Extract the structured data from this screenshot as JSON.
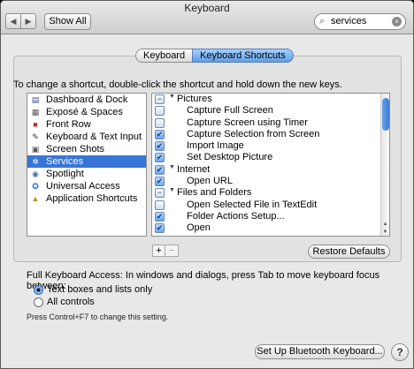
{
  "window": {
    "title": "Keyboard"
  },
  "toolbar": {
    "back_icon": "◀",
    "fwd_icon": "▶",
    "show_all_label": "Show All"
  },
  "search": {
    "value": "services",
    "icon": "⌕",
    "clear_icon": "×"
  },
  "tabs": [
    {
      "label": "Keyboard",
      "selected": false
    },
    {
      "label": "Keyboard Shortcuts",
      "selected": true
    }
  ],
  "instructions": "To change a shortcut, double-click the shortcut and hold down the new keys.",
  "categories": [
    {
      "label": "Dashboard & Dock",
      "icon": "dashboard-icon",
      "glyph": "▤",
      "color": "#3e4f8c",
      "selected": false
    },
    {
      "label": "Exposé & Spaces",
      "icon": "expose-icon",
      "glyph": "▦",
      "color": "#555",
      "selected": false
    },
    {
      "label": "Front Row",
      "icon": "front-row-icon",
      "glyph": "■",
      "color": "#b33",
      "selected": false
    },
    {
      "label": "Keyboard & Text Input",
      "icon": "pen-icon",
      "glyph": "✎",
      "color": "#333",
      "selected": false
    },
    {
      "label": "Screen Shots",
      "icon": "camera-icon",
      "glyph": "▣",
      "color": "#555",
      "selected": false
    },
    {
      "label": "Services",
      "icon": "gear-icon",
      "glyph": "✲",
      "color": "#ffffff",
      "selected": true
    },
    {
      "label": "Spotlight",
      "icon": "spotlight-icon",
      "glyph": "◉",
      "color": "#4a6fa5",
      "selected": false
    },
    {
      "label": "Universal Access",
      "icon": "universal-access-icon",
      "glyph": "✪",
      "color": "#2a64c8",
      "selected": false
    },
    {
      "label": "Application Shortcuts",
      "icon": "app-icon",
      "glyph": "▲",
      "color": "#c08a20",
      "selected": false
    }
  ],
  "shortcuts": [
    {
      "label": "Pictures",
      "type": "group",
      "check": "mixed",
      "expanded": true
    },
    {
      "label": "Capture Full Screen",
      "type": "item",
      "check": "off"
    },
    {
      "label": "Capture Screen using Timer",
      "type": "item",
      "check": "off"
    },
    {
      "label": "Capture Selection from Screen",
      "type": "item",
      "check": "on"
    },
    {
      "label": "Import Image",
      "type": "item",
      "check": "on"
    },
    {
      "label": "Set Desktop Picture",
      "type": "item",
      "check": "on"
    },
    {
      "label": "Internet",
      "type": "group",
      "check": "on",
      "expanded": true
    },
    {
      "label": "Open URL",
      "type": "item",
      "check": "on"
    },
    {
      "label": "Files and Folders",
      "type": "group",
      "check": "mixed",
      "expanded": true
    },
    {
      "label": "Open Selected File in TextEdit",
      "type": "item",
      "check": "off"
    },
    {
      "label": "Folder Actions Setup...",
      "type": "item",
      "check": "on"
    },
    {
      "label": "Open",
      "type": "item",
      "check": "on"
    }
  ],
  "list_buttons": {
    "add": "+",
    "remove": "−"
  },
  "restore_label": "Restore Defaults",
  "full_keyboard_access": {
    "label": "Full Keyboard Access: In windows and dialogs, press Tab to move keyboard focus between:",
    "options": [
      {
        "label": "Text boxes and lists only",
        "selected": true
      },
      {
        "label": "All controls",
        "selected": false
      }
    ],
    "note": "Press Control+F7 to change this setting."
  },
  "bluetooth_label": "Set Up Bluetooth Keyboard...",
  "help_label": "?"
}
